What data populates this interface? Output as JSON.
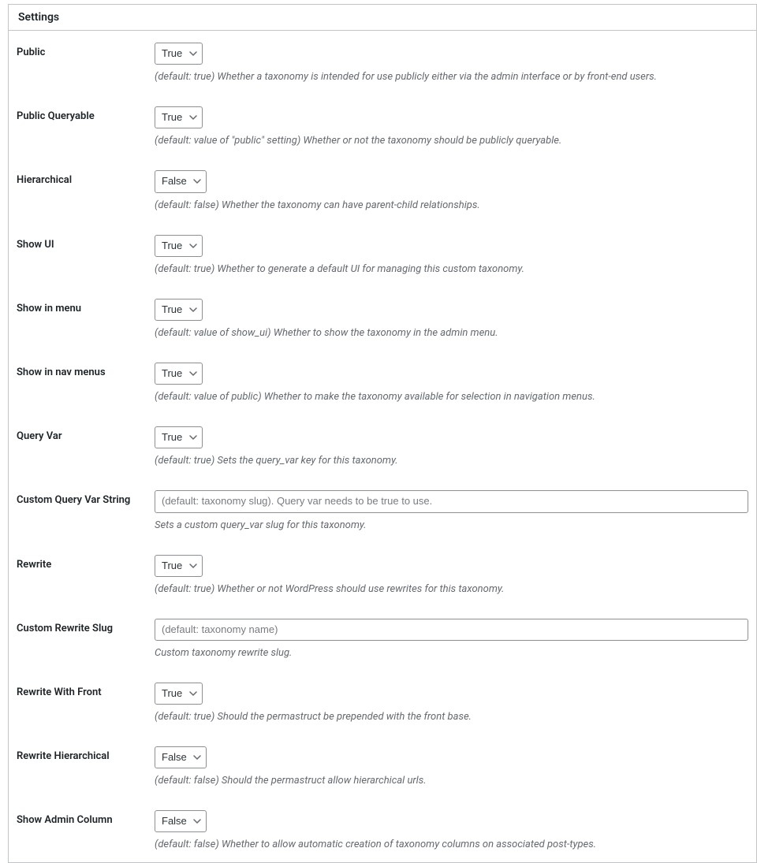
{
  "panel": {
    "title": "Settings"
  },
  "options": {
    "true": "True",
    "false": "False"
  },
  "rows": {
    "public": {
      "label": "Public",
      "value": "True",
      "desc": "(default: true) Whether a taxonomy is intended for use publicly either via the admin interface or by front-end users."
    },
    "public_queryable": {
      "label": "Public Queryable",
      "value": "True",
      "desc": "(default: value of \"public\" setting) Whether or not the taxonomy should be publicly queryable."
    },
    "hierarchical": {
      "label": "Hierarchical",
      "value": "False",
      "desc": "(default: false) Whether the taxonomy can have parent-child relationships."
    },
    "show_ui": {
      "label": "Show UI",
      "value": "True",
      "desc": "(default: true) Whether to generate a default UI for managing this custom taxonomy."
    },
    "show_in_menu": {
      "label": "Show in menu",
      "value": "True",
      "desc": "(default: value of show_ui) Whether to show the taxonomy in the admin menu."
    },
    "show_in_nav_menus": {
      "label": "Show in nav menus",
      "value": "True",
      "desc": "(default: value of public) Whether to make the taxonomy available for selection in navigation menus."
    },
    "query_var": {
      "label": "Query Var",
      "value": "True",
      "desc": "(default: true) Sets the query_var key for this taxonomy."
    },
    "custom_query_var": {
      "label": "Custom Query Var String",
      "placeholder": "(default: taxonomy slug). Query var needs to be true to use.",
      "desc": "Sets a custom query_var slug for this taxonomy."
    },
    "rewrite": {
      "label": "Rewrite",
      "value": "True",
      "desc": "(default: true) Whether or not WordPress should use rewrites for this taxonomy."
    },
    "custom_rewrite_slug": {
      "label": "Custom Rewrite Slug",
      "placeholder": "(default: taxonomy name)",
      "desc": "Custom taxonomy rewrite slug."
    },
    "rewrite_with_front": {
      "label": "Rewrite With Front",
      "value": "True",
      "desc": "(default: true) Should the permastruct be prepended with the front base."
    },
    "rewrite_hierarchical": {
      "label": "Rewrite Hierarchical",
      "value": "False",
      "desc": "(default: false) Should the permastruct allow hierarchical urls."
    },
    "show_admin_column": {
      "label": "Show Admin Column",
      "value": "False",
      "desc": "(default: false) Whether to allow automatic creation of taxonomy columns on associated post-types."
    }
  }
}
